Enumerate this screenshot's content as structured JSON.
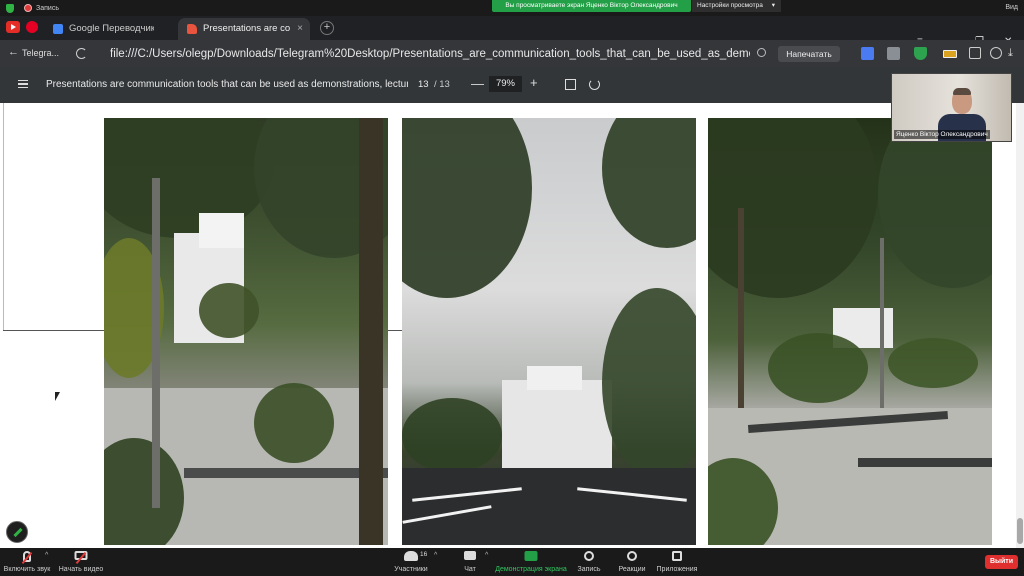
{
  "zoom_top": {
    "recording_label": "Запись",
    "share_banner": "Вы просматриваете экран Яценко Віктор Олександрович",
    "view_settings": "Настройки просмотра",
    "view_button": "Вид"
  },
  "browser": {
    "tabs": [
      {
        "label": "Google Переводчик",
        "close": "×"
      },
      {
        "label": "Presentations are communication tools",
        "close": "×"
      }
    ],
    "new_tab": "+",
    "window_controls": [
      "≡",
      "—",
      "❐",
      "✕"
    ],
    "back_label": "Telegra...",
    "url": "file:///C:/Users/olegp/Downloads/Telegram%20Desktop/Presentations_are_communication_tools_that_can_be_used_as_demonst...",
    "print_label": "Напечатать",
    "download_icon": "⤓"
  },
  "pdf_toolbar": {
    "title": "Presentations are communication tools that can be used as demonstrations, lecture...",
    "page_current": "13",
    "page_total": "/ 13",
    "zoom_minus": "—",
    "zoom_value": "79%",
    "zoom_plus": "+"
  },
  "self_video": {
    "name": "Яценко Віктор Олександрович"
  },
  "zoom_bottom": {
    "items": [
      {
        "label": "Включить звук"
      },
      {
        "label": "Начать видео"
      },
      {
        "label": "Участники"
      },
      {
        "label": "Чат"
      },
      {
        "label": "Демонстрация экрана"
      },
      {
        "label": "Запись"
      },
      {
        "label": "Реакции"
      },
      {
        "label": "Приложения"
      }
    ],
    "participants_count": "16",
    "leave_label": "Выйти"
  },
  "colors": {
    "zoom_green": "#23a047",
    "leave_red": "#e02f2f",
    "browser_dark": "#202124",
    "pdf_toolbar": "#323639"
  }
}
